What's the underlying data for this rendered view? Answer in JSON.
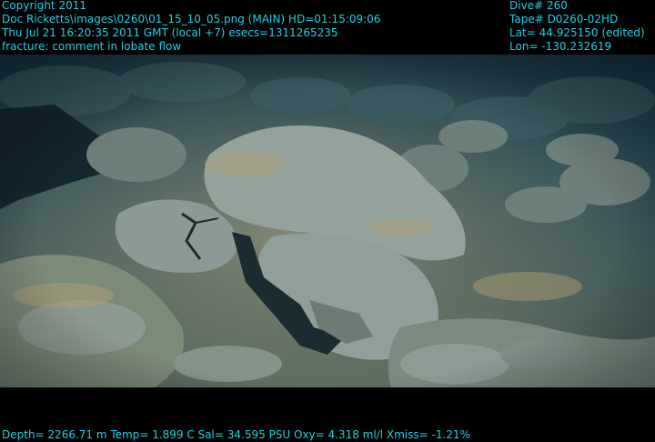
{
  "overlay": {
    "text_color": "#19d3e6",
    "top_left": [
      "Copyright 2011",
      "Doc Ricketts\\images\\0260\\01_15_10_05.png (MAIN)  HD=01:15:09:06",
      "Thu Jul 21 16:20:35 2011 GMT (local +7)  esecs=1311265235",
      "fracture: comment in lobate flow"
    ],
    "top_right": [
      "Dive# 260",
      "Tape# D0260-02HD",
      "Lat= 44.925150 (edited)",
      "Lon= -130.232619"
    ],
    "bottom": "Depth= 2266.71 m  Temp= 1.899 C  Sal= 34.595 PSU  Oxy= 4.318 ml/l  Xmiss= -1.21%"
  },
  "scene": {
    "subject": "seafloor-lobate-lava-flow",
    "colors": {
      "water": "#1f4254",
      "sediment": "#6f7f6a",
      "rock": "#8a9b98",
      "shadow": "#0f1e24"
    }
  }
}
